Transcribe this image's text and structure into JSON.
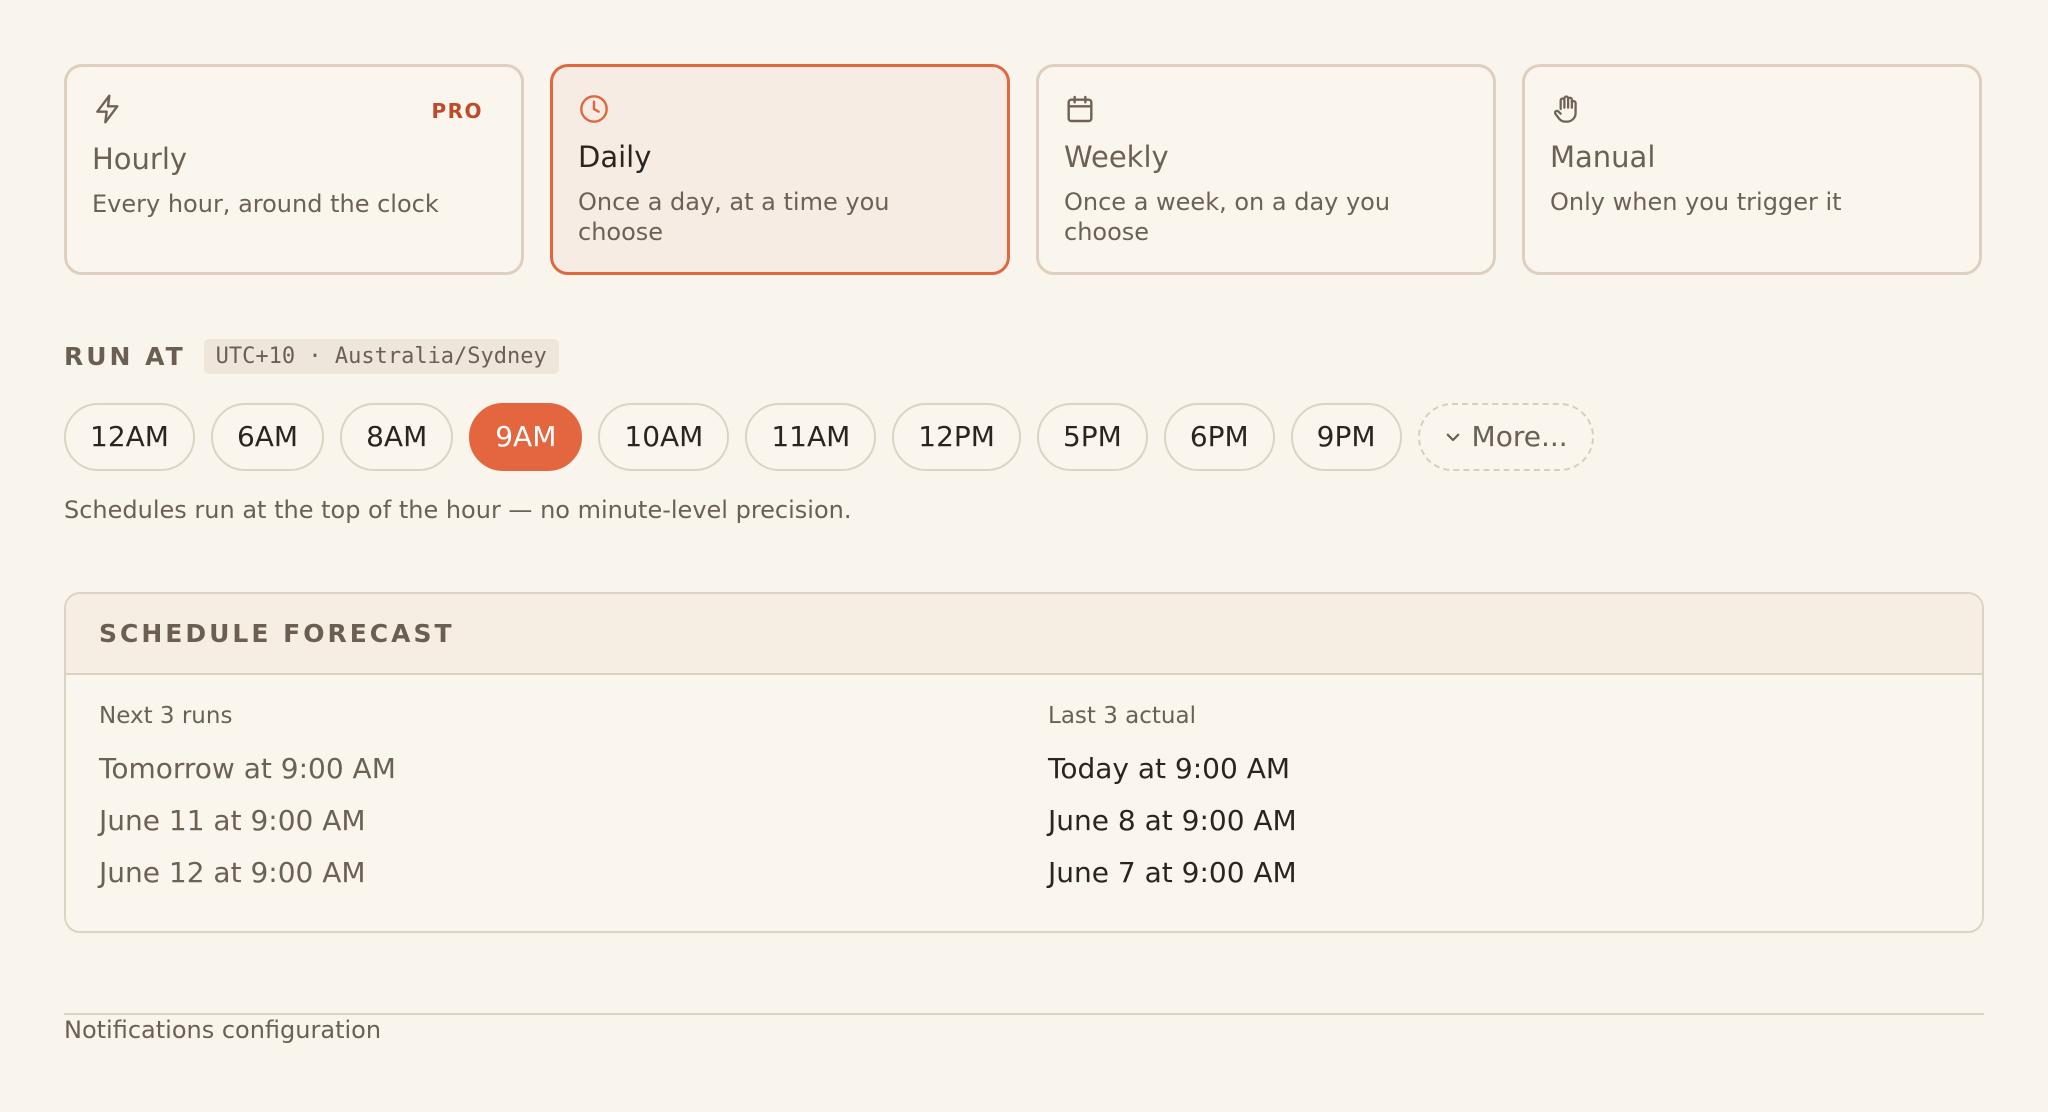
{
  "frequency_cards": [
    {
      "title": "Hourly",
      "description": "Every hour, around the clock",
      "badge": "PRO",
      "icon": "lightning-icon"
    },
    {
      "title": "Daily",
      "description": "Once a day, at a time you choose",
      "icon": "clock-icon",
      "selected": true
    },
    {
      "title": "Weekly",
      "description": "Once a week, on a day you choose",
      "icon": "calendar-icon"
    },
    {
      "title": "Manual",
      "description": "Only when you trigger it",
      "icon": "hand-icon"
    }
  ],
  "run_at": {
    "label": "RUN AT",
    "timezone": "UTC+10 · Australia/Sydney",
    "times": [
      "12AM",
      "6AM",
      "8AM",
      "9AM",
      "10AM",
      "11AM",
      "12PM",
      "5PM",
      "6PM",
      "9PM"
    ],
    "selected_time": "9AM",
    "more_label": "More...",
    "hint": "Schedules run at the top of the hour — no minute-level precision."
  },
  "forecast": {
    "title": "SCHEDULE FORECAST",
    "next_title": "Next 3 runs",
    "next_runs": [
      "Tomorrow at 9:00 AM",
      "June 11 at 9:00 AM",
      "June 12 at 9:00 AM"
    ],
    "last_title": "Last 3 actual",
    "last_runs": [
      "Today at 9:00 AM",
      "June 8 at 9:00 AM",
      "June 7 at 9:00 AM"
    ]
  },
  "footer": {
    "link_label": "Notifications configuration"
  },
  "colors": {
    "accent": "#e3663e",
    "background": "#f9f5ec",
    "border": "#ddd3c5",
    "pro_badge": "#bf4a2a"
  }
}
